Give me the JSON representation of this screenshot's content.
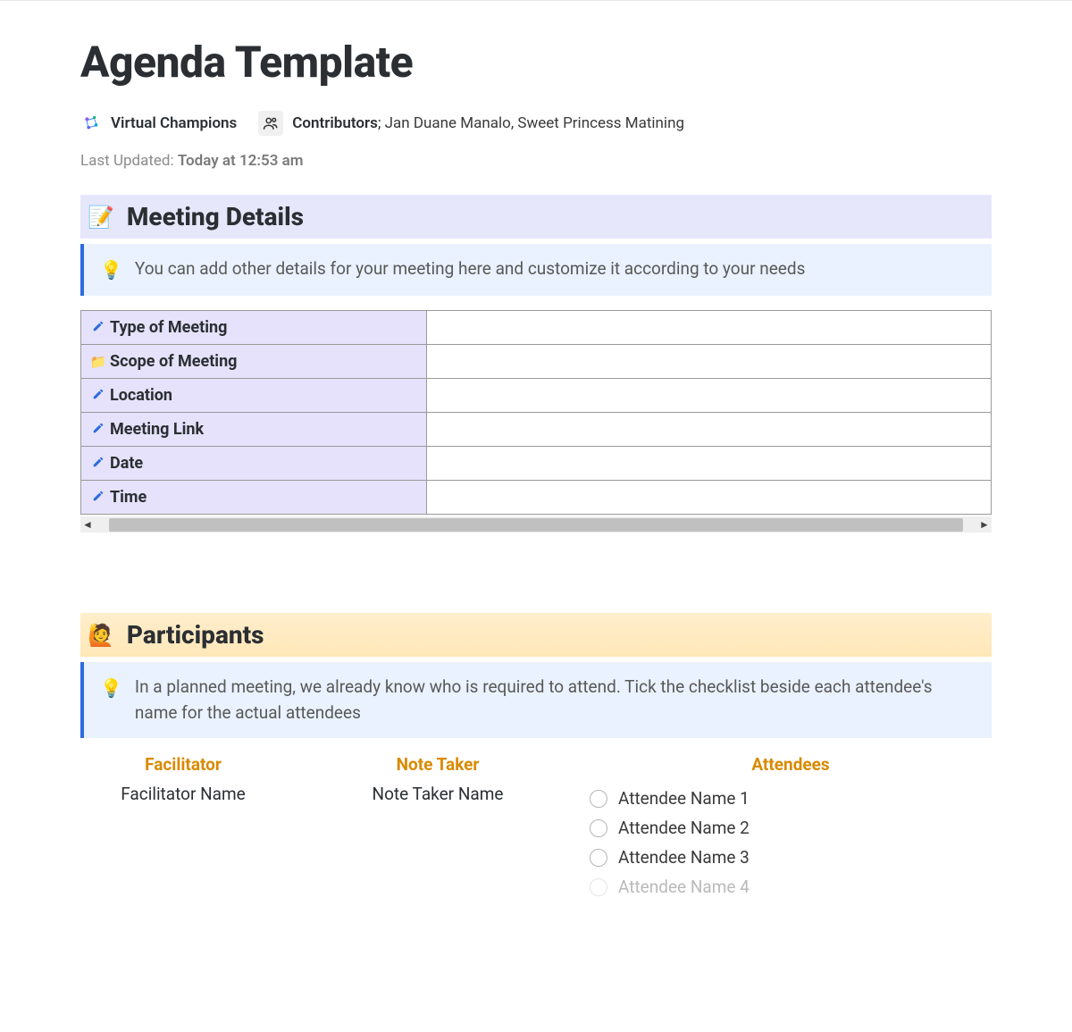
{
  "pageTitle": "Agenda Template",
  "workspace": {
    "name": "Virtual Champions"
  },
  "contributors": {
    "label": "Contributors",
    "names": "Jan Duane Manalo, Sweet Princess Matining"
  },
  "lastUpdated": {
    "label": "Last Updated:",
    "value": "Today at 12:53 am"
  },
  "meetingDetails": {
    "title": "Meeting Details",
    "tip": "You can add other details for your meeting here and customize it according to your needs",
    "rows": [
      {
        "icon": "pencil",
        "label": "Type of Meeting",
        "value": ""
      },
      {
        "icon": "folder",
        "label": "Scope of Meeting",
        "value": ""
      },
      {
        "icon": "pencil",
        "label": "Location",
        "value": ""
      },
      {
        "icon": "pencil",
        "label": "Meeting Link",
        "value": ""
      },
      {
        "icon": "pencil",
        "label": "Date",
        "value": ""
      },
      {
        "icon": "pencil",
        "label": "Time",
        "value": ""
      }
    ]
  },
  "participants": {
    "title": "Participants",
    "tip": "In a planned meeting, we already know who is required to attend. Tick the checklist beside each attendee's name for the actual attendees",
    "facilitator": {
      "head": "Facilitator",
      "name": "Facilitator Name"
    },
    "noteTaker": {
      "head": "Note Taker",
      "name": "Note Taker Name"
    },
    "attendees": {
      "head": "Attendees",
      "list": [
        {
          "name": "Attendee Name 1",
          "checked": false
        },
        {
          "name": "Attendee Name 2",
          "checked": false
        },
        {
          "name": "Attendee Name 3",
          "checked": false
        },
        {
          "name": "Attendee Name 4",
          "checked": false
        }
      ]
    }
  }
}
